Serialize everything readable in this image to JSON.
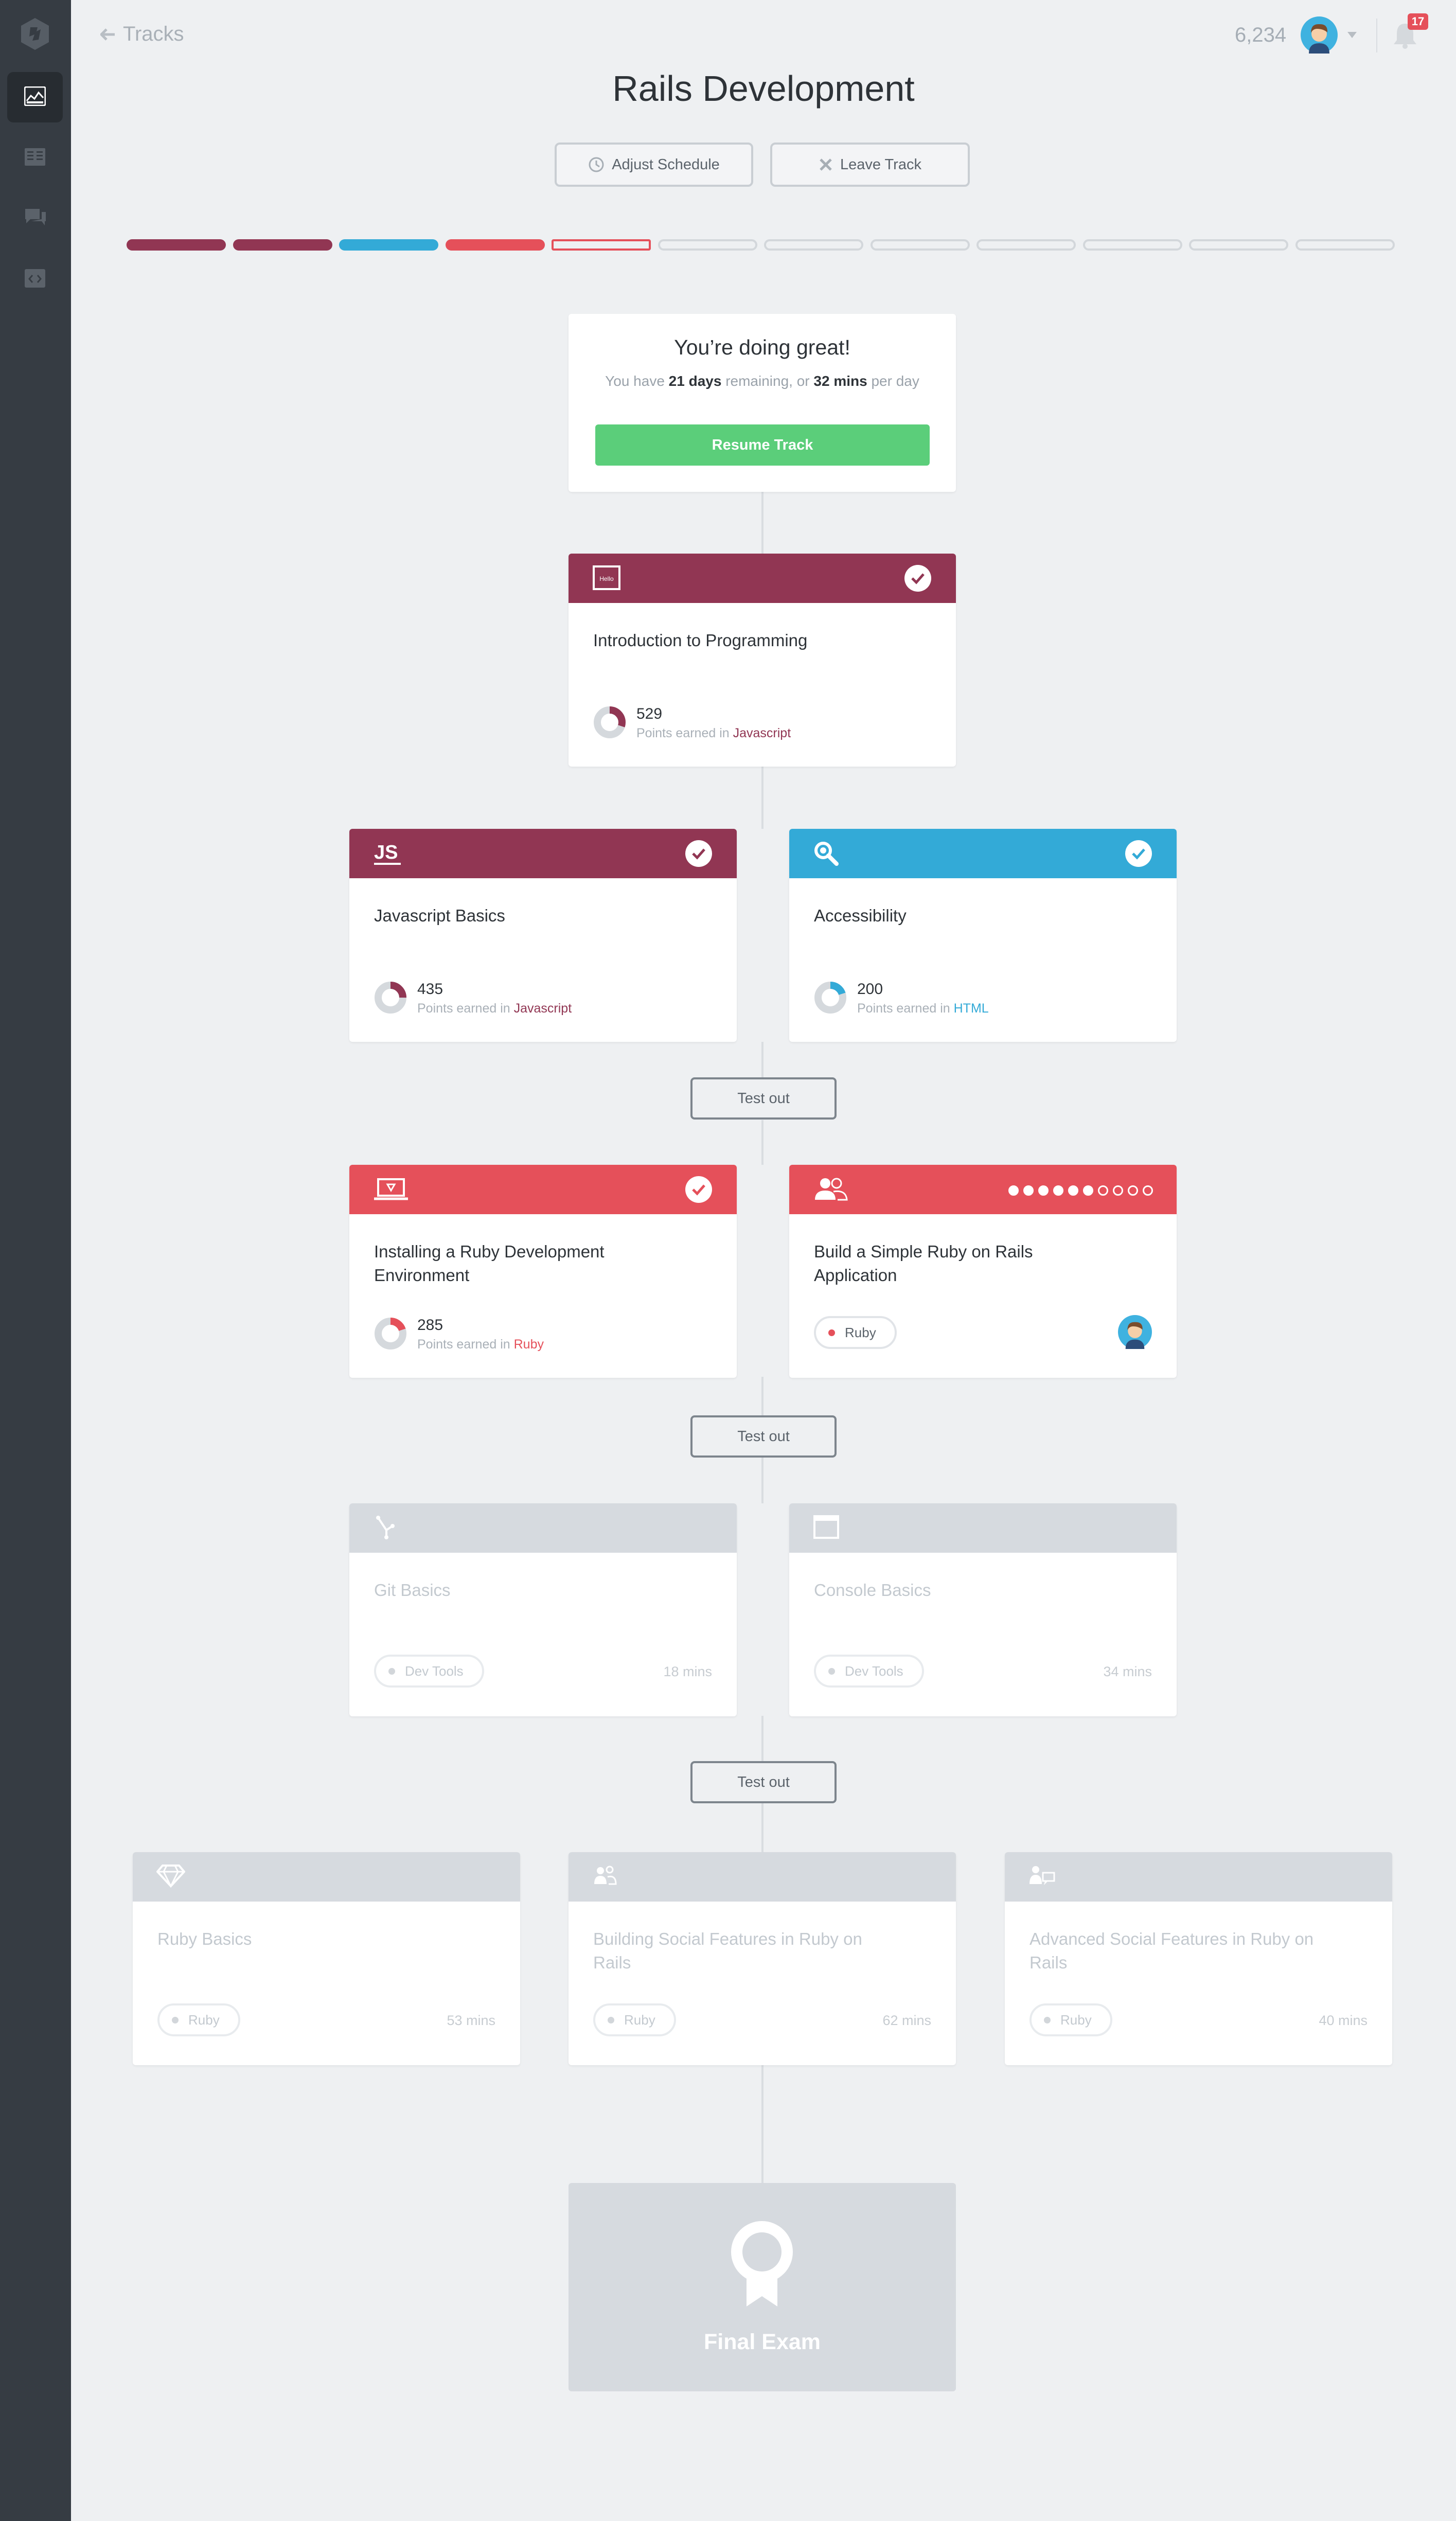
{
  "nav": {
    "back_label": "Tracks",
    "points": "6,234",
    "notifications": "17"
  },
  "page": {
    "title": "Rails Development",
    "adjust_label": "Adjust Schedule",
    "leave_label": "Leave Track"
  },
  "progress": {
    "segments": [
      {
        "state": "complete",
        "color": "#913653"
      },
      {
        "state": "complete",
        "color": "#913653"
      },
      {
        "state": "complete",
        "color": "#33aad7"
      },
      {
        "state": "complete",
        "color": "#e5505a"
      },
      {
        "state": "current",
        "color": "#e5505a"
      },
      {
        "state": "todo",
        "color": "#d3d7db"
      },
      {
        "state": "todo",
        "color": "#d3d7db"
      },
      {
        "state": "todo",
        "color": "#d3d7db"
      },
      {
        "state": "todo",
        "color": "#d3d7db"
      },
      {
        "state": "todo",
        "color": "#d3d7db"
      },
      {
        "state": "todo",
        "color": "#d3d7db"
      },
      {
        "state": "todo",
        "color": "#d3d7db"
      }
    ]
  },
  "status": {
    "title": "You’re doing great!",
    "prefix": "You have ",
    "days": "21 days",
    "middle": " remaining, or ",
    "mins": "32 mins",
    "suffix": " per day",
    "resume_label": "Resume Track"
  },
  "cards": {
    "intro": {
      "title": "Introduction to Programming",
      "points": "529",
      "earned_in": "Points earned in ",
      "topic": "Javascript",
      "color": "#913653",
      "fraction": 0.3,
      "icon": "hello-icon"
    },
    "js_basics": {
      "title": "Javascript Basics",
      "points": "435",
      "earned_in": "Points earned in ",
      "topic": "Javascript",
      "color": "#913653",
      "fraction": 0.25,
      "icon_text": "JS"
    },
    "accessibility": {
      "title": "Accessibility",
      "points": "200",
      "earned_in": "Points earned in ",
      "topic": "HTML",
      "color": "#33aad7",
      "fraction": 0.2,
      "icon": "magnifier-icon"
    },
    "ruby_env": {
      "title": "Installing a Ruby Development Environment",
      "points": "285",
      "earned_in": "Points earned in ",
      "topic": "Ruby",
      "color": "#e5505a",
      "fraction": 0.2,
      "icon": "laptop-icon"
    },
    "simple_rails": {
      "title": "Build a Simple Ruby on Rails Application",
      "pill": "Ruby",
      "color": "#e5505a",
      "steps_done": 6,
      "steps_total": 10,
      "icon": "people-icon"
    },
    "git_basics": {
      "title": "Git Basics",
      "pill": "Dev Tools",
      "duration": "18 mins",
      "icon": "git-icon"
    },
    "console_basics": {
      "title": "Console Basics",
      "pill": "Dev Tools",
      "duration": "34 mins",
      "icon": "window-icon"
    },
    "ruby_basics": {
      "title": "Ruby Basics",
      "pill": "Ruby",
      "duration": "53 mins",
      "icon": "gem-icon"
    },
    "social_features": {
      "title": "Building Social Features in Ruby on Rails",
      "pill": "Ruby",
      "duration": "62 mins",
      "icon": "people-icon"
    },
    "adv_social": {
      "title": "Advanced Social Features in Ruby on Rails",
      "pill": "Ruby",
      "duration": "40 mins",
      "icon": "people-chat-icon"
    }
  },
  "test_out_label": "Test out",
  "final_exam": {
    "label": "Final Exam"
  },
  "colors": {
    "locked_header": "#d6dadf",
    "ruby_dot": "#e5505a",
    "locked_dot": "#d2d6da"
  }
}
